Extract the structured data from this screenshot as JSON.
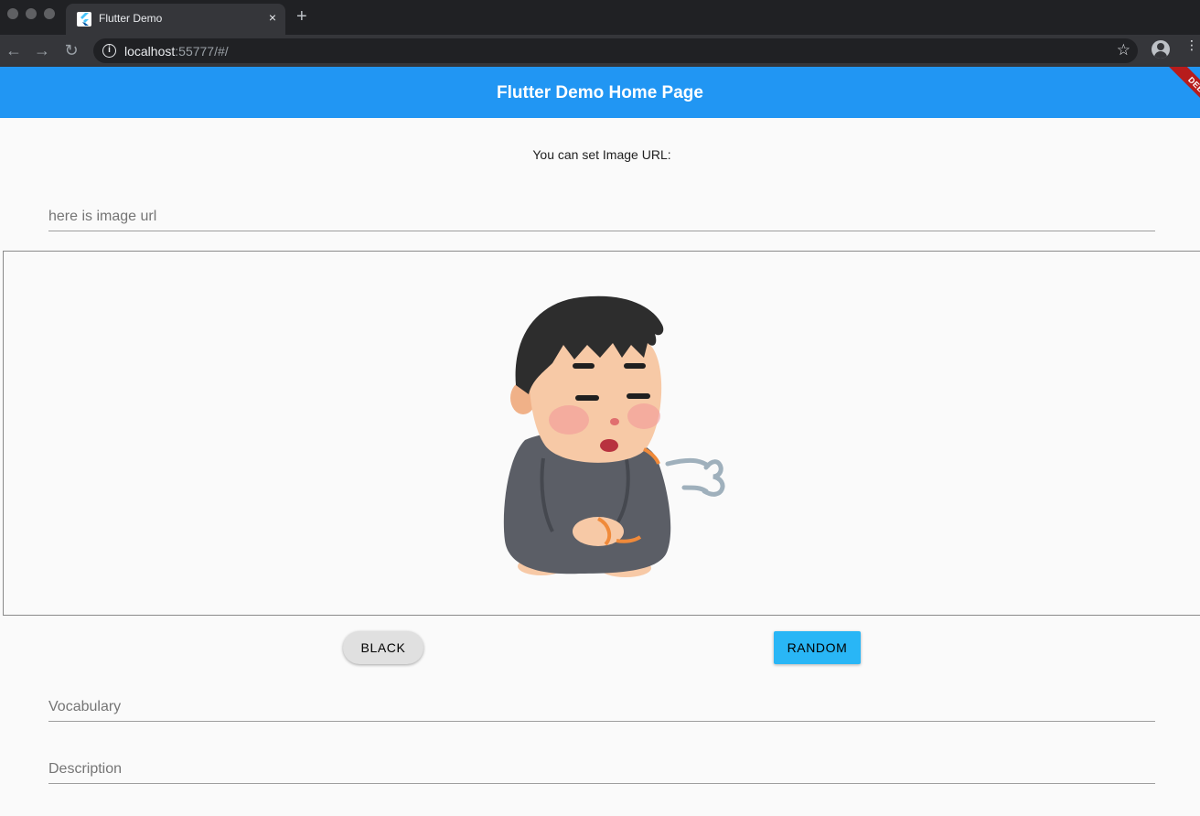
{
  "browser": {
    "tab_title": "Flutter Demo",
    "tab_close": "×",
    "new_tab": "+",
    "url_host": "localhost",
    "url_rest": ":55777/#/",
    "back": "←",
    "forward": "→",
    "reload": "↻",
    "star": "☆",
    "info": "i",
    "menu": "⋮"
  },
  "app": {
    "title": "Flutter Demo Home Page",
    "debug_banner": "DEBUG",
    "accent": "#2196f3"
  },
  "main": {
    "prompt": "You can set Image URL:",
    "image_url_placeholder": "here is image url",
    "black_button": "BLACK",
    "random_button": "RANDOM",
    "vocabulary_placeholder": "Vocabulary",
    "description_placeholder": "Description"
  }
}
